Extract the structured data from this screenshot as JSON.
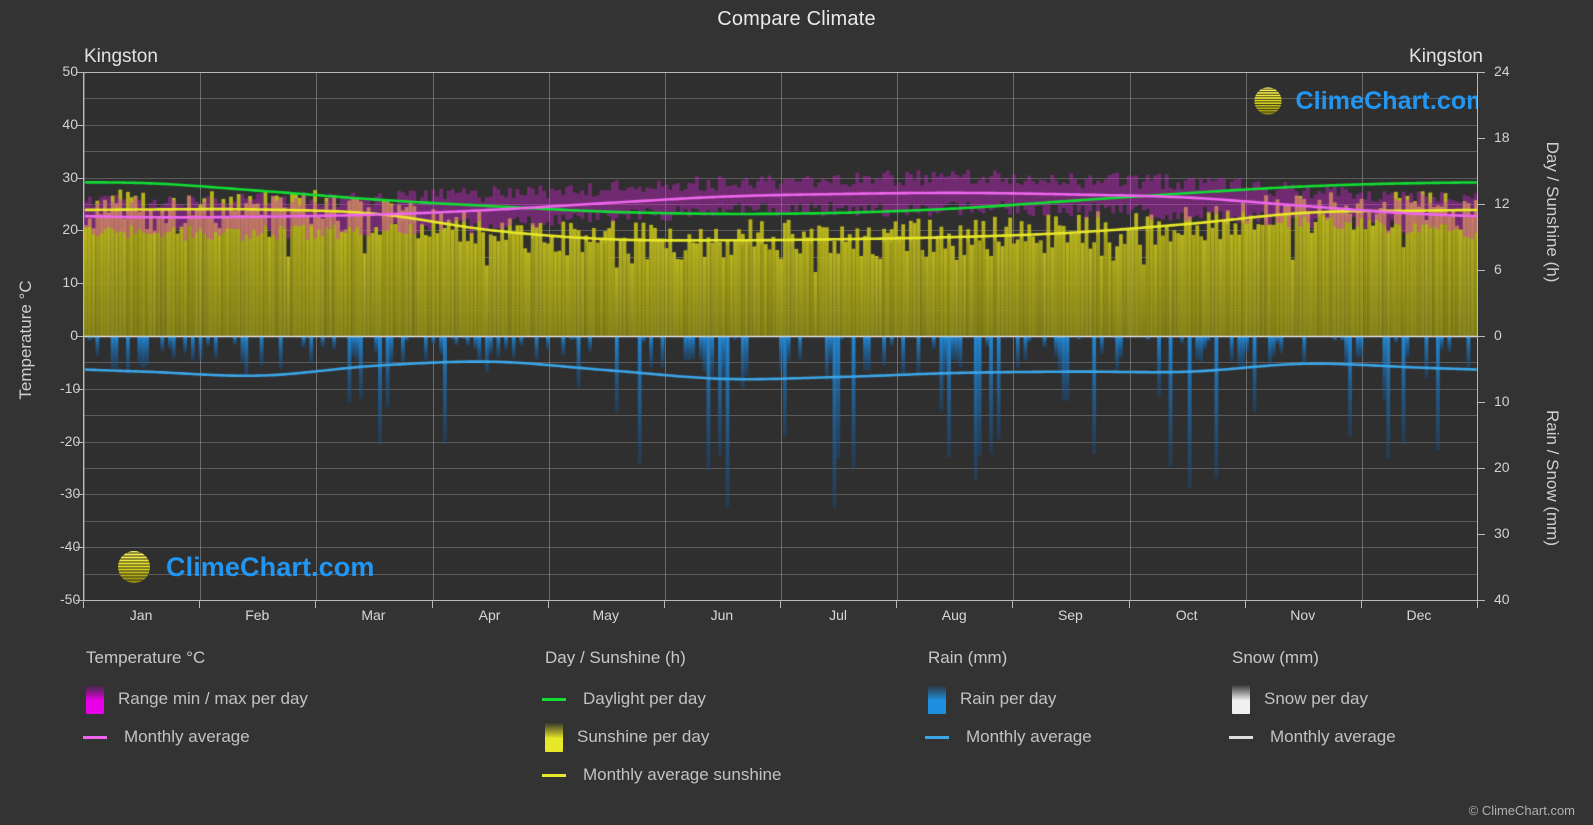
{
  "header": {
    "title": "Compare Climate",
    "station_left": "Kingston",
    "station_right": "Kingston"
  },
  "axes": {
    "left_title": "Temperature °C",
    "right_top_title": "Day / Sunshine (h)",
    "right_bottom_title": "Rain / Snow (mm)",
    "left_ticks": [
      "50",
      "40",
      "30",
      "20",
      "10",
      "0",
      "-10",
      "-20",
      "-30",
      "-40",
      "-50"
    ],
    "right_top_ticks": [
      "24",
      "18",
      "12",
      "6",
      "0"
    ],
    "right_bottom_ticks": [
      "10",
      "20",
      "30",
      "40"
    ],
    "months": [
      "Jan",
      "Feb",
      "Mar",
      "Apr",
      "May",
      "Jun",
      "Jul",
      "Aug",
      "Sep",
      "Oct",
      "Nov",
      "Dec"
    ]
  },
  "legend": {
    "temperature": {
      "heading": "Temperature °C",
      "items": [
        {
          "label": "Range min / max per day",
          "type": "box",
          "color": "#e800e8"
        },
        {
          "label": "Monthly average",
          "type": "line",
          "color": "#ee66ee"
        }
      ]
    },
    "daysunshine": {
      "heading": "Day / Sunshine (h)",
      "items": [
        {
          "label": "Daylight per day",
          "type": "line",
          "color": "#11dd33"
        },
        {
          "label": "Sunshine per day",
          "type": "box",
          "color": "#e8e82a"
        },
        {
          "label": "Monthly average sunshine",
          "type": "line",
          "color": "#e8e82a"
        }
      ]
    },
    "rain": {
      "heading": "Rain (mm)",
      "items": [
        {
          "label": "Rain per day",
          "type": "box",
          "color": "#1f8fe0"
        },
        {
          "label": "Monthly average",
          "type": "line",
          "color": "#3ba5e8"
        }
      ]
    },
    "snow": {
      "heading": "Snow (mm)",
      "items": [
        {
          "label": "Snow per day",
          "type": "box",
          "color": "#f0f0f0"
        },
        {
          "label": "Monthly average",
          "type": "line",
          "color": "#dddddd"
        }
      ]
    },
    "copyright": "© ClimeChart.com"
  },
  "branding": {
    "logo_text": "ClimeChart.com",
    "logo_text_color": "#2196f3",
    "crescent_color": "#e020e0",
    "sphere_color": "#d6d020"
  },
  "colors": {
    "background": "#333333",
    "plot_background": "#2f2f2f",
    "axis": "#b9b9b9",
    "grid": "#5b5b5b",
    "daylight": "#11dd33",
    "sunshine": "#e8e82a",
    "temperature": "#ee66ee",
    "temperature_range": "#e800e8",
    "rain": "#1f8fe0",
    "rain_average": "#3ba5e8",
    "snow": "#e8e8e8"
  },
  "chart_data": {
    "type": "line",
    "title": "Compare Climate",
    "subtitle": "Kingston",
    "xlabel": "",
    "ylabel": "Temperature °C",
    "y2label_top": "Day / Sunshine (h)",
    "y2label_bottom": "Rain / Snow (mm)",
    "grid": true,
    "legend_position": "bottom",
    "categories": [
      "Jan",
      "Feb",
      "Mar",
      "Apr",
      "May",
      "Jun",
      "Jul",
      "Aug",
      "Sep",
      "Oct",
      "Nov",
      "Dec"
    ],
    "ylim_temperature": [
      -50,
      50
    ],
    "ylim_day_sunshine": [
      0,
      24
    ],
    "ylim_rain_snow": [
      0,
      40
    ],
    "series": [
      {
        "name": "Daylight per day",
        "unit": "h",
        "axis": "day_sunshine",
        "color": "#11dd33",
        "values": [
          13.9,
          13.2,
          12.4,
          11.8,
          11.3,
          11.1,
          11.2,
          11.6,
          12.3,
          13.0,
          13.6,
          13.9
        ]
      },
      {
        "name": "Monthly average sunshine",
        "unit": "h",
        "axis": "day_sunshine",
        "color": "#e8e82a",
        "values": [
          11.5,
          11.5,
          11.1,
          9.6,
          8.8,
          8.7,
          8.8,
          9.0,
          9.4,
          10.2,
          11.2,
          11.4
        ]
      },
      {
        "name": "Temperature monthly average",
        "unit": "°C",
        "axis": "temperature",
        "color": "#ee66ee",
        "values": [
          22.5,
          22.6,
          23.0,
          23.9,
          25.2,
          26.4,
          26.9,
          27.1,
          26.8,
          26.2,
          24.6,
          23.1
        ]
      },
      {
        "name": "Temperature range min / max per day",
        "unit": "°C",
        "axis": "temperature",
        "color": "#e800e8",
        "min": [
          19.5,
          19.5,
          20.0,
          21.0,
          22.5,
          23.7,
          24.0,
          24.1,
          23.8,
          23.2,
          21.8,
          20.3
        ],
        "max": [
          25.5,
          25.7,
          26.1,
          26.9,
          27.9,
          29.0,
          29.7,
          30.0,
          29.6,
          29.0,
          27.5,
          26.0
        ]
      },
      {
        "name": "Rain monthly average",
        "unit": "mm",
        "axis": "rain_snow",
        "color": "#3ba5e8",
        "values": [
          5.4,
          6.0,
          4.5,
          3.9,
          5.2,
          6.5,
          6.2,
          5.6,
          5.4,
          5.4,
          4.2,
          4.8
        ]
      },
      {
        "name": "Snow monthly average",
        "unit": "mm",
        "axis": "rain_snow",
        "color": "#dddddd",
        "values": [
          0,
          0,
          0,
          0,
          0,
          0,
          0,
          0,
          0,
          0,
          0,
          0
        ]
      }
    ]
  }
}
